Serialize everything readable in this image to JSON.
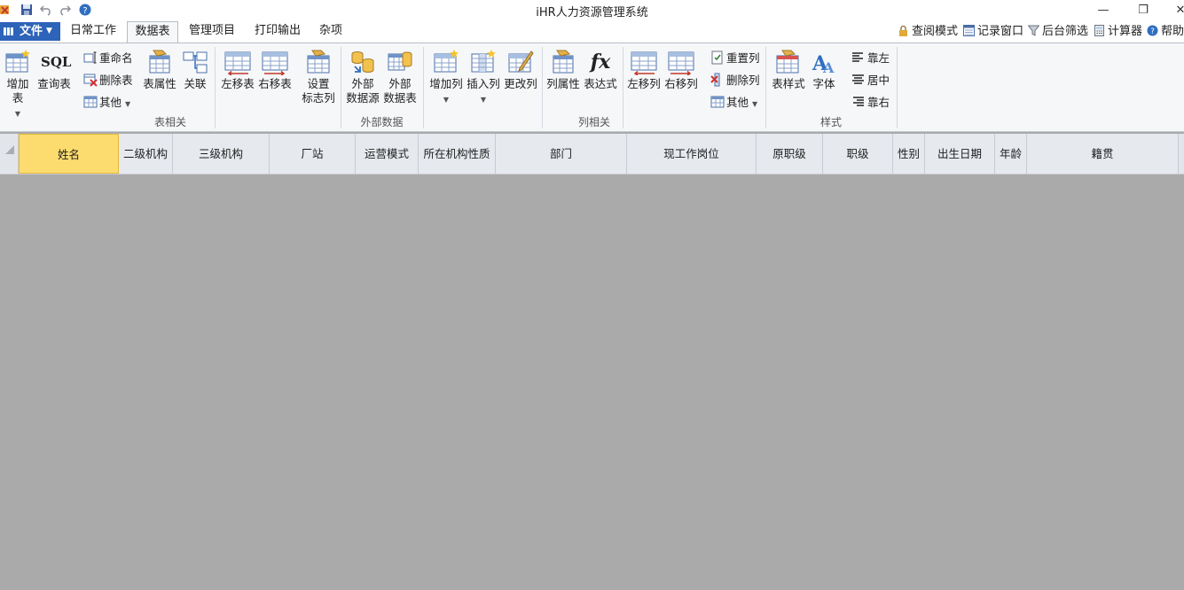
{
  "window": {
    "title": "iHR人力资源管理系统"
  },
  "file_menu": {
    "label": "文件"
  },
  "tabs": [
    {
      "label": "日常工作"
    },
    {
      "label": "数据表"
    },
    {
      "label": "管理项目"
    },
    {
      "label": "打印输出"
    },
    {
      "label": "杂项"
    }
  ],
  "active_tab": "数据表",
  "right_tools": [
    {
      "label": "查阅模式",
      "icon": "lock-icon"
    },
    {
      "label": "记录窗口",
      "icon": "window-icon"
    },
    {
      "label": "后台筛选",
      "icon": "filter-icon"
    },
    {
      "label": "计算器",
      "icon": "calculator-icon"
    },
    {
      "label": "帮助",
      "icon": "help-icon"
    }
  ],
  "ribbon": {
    "table_group": {
      "label": "表相关",
      "add_table": "增加表",
      "query_table": "查询表",
      "sql_text": "SQL",
      "rename": "重命名",
      "delete_table": "删除表",
      "other": "其他",
      "table_props": "表属性",
      "relation": "关联",
      "move_left": "左移表",
      "move_right": "右移表",
      "set_flag_col_1": "设置",
      "set_flag_col_2": "标志列"
    },
    "external_group": {
      "label": "外部数据",
      "ext_source_1": "外部",
      "ext_source_2": "数据源",
      "ext_table_1": "外部",
      "ext_table_2": "数据表"
    },
    "column_group": {
      "label": "列相关",
      "add_col": "增加列",
      "insert_col": "插入列",
      "change_col": "更改列",
      "col_props": "列属性",
      "expression": "表达式",
      "fx_text": "fx",
      "move_left": "左移列",
      "move_right": "右移列",
      "reset_col": "重置列",
      "delete_col": "删除列",
      "other": "其他"
    },
    "style_group": {
      "label": "样式",
      "table_style": "表样式",
      "font": "字体",
      "align_left": "靠左",
      "align_center": "居中",
      "align_right": "靠右"
    }
  },
  "grid": {
    "columns": [
      "姓名",
      "二级机构",
      "三级机构",
      "厂站",
      "运营模式",
      "所在机构性质",
      "部门",
      "现工作岗位",
      "原职级",
      "职级",
      "性别",
      "出生日期",
      "年龄",
      "籍贯"
    ],
    "selected_column": "姓名"
  },
  "colors": {
    "file_blue": "#2d63b8",
    "selected_header": "#fddc6f",
    "empty_area": "#aaaaaa"
  }
}
